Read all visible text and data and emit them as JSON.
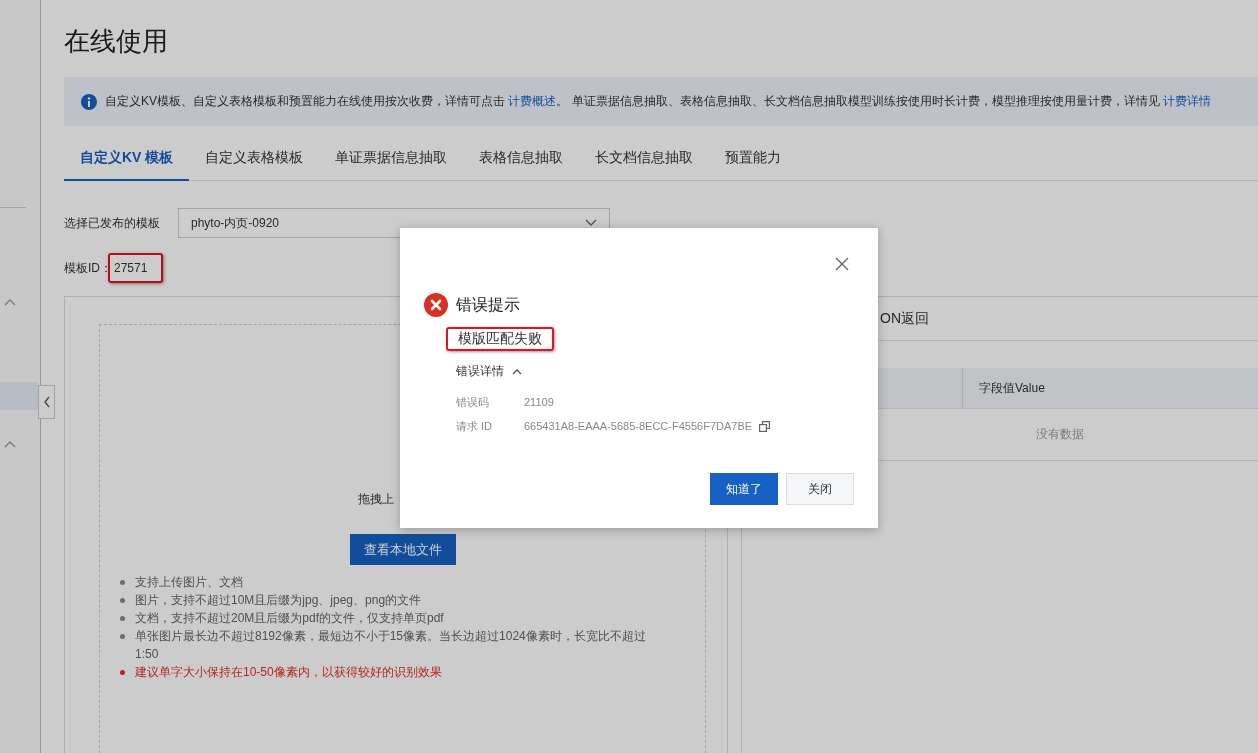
{
  "page_title": "在线使用",
  "notice": {
    "segments": [
      {
        "kind": "text",
        "text": "自定义KV模板、自定义表格模板和预置能力在线使用按次收费，详情可点击 "
      },
      {
        "kind": "link",
        "text": "计费概述"
      },
      {
        "kind": "text",
        "text": "。 单证票据信息抽取、表格信息抽取、长文档信息抽取模型训练按使用时长计费，模型推理按使用量计费，详情见 "
      },
      {
        "kind": "link",
        "text": "计费详情"
      }
    ]
  },
  "tabs": [
    {
      "label": "自定义KV 模板",
      "selected": true
    },
    {
      "label": "自定义表格模板",
      "selected": false
    },
    {
      "label": "单证票据信息抽取",
      "selected": false
    },
    {
      "label": "表格信息抽取",
      "selected": false
    },
    {
      "label": "长文档信息抽取",
      "selected": false
    },
    {
      "label": "预置能力",
      "selected": false
    }
  ],
  "template_select": {
    "label": "选择已发布的模板",
    "value": "phyto-内页-0920"
  },
  "template_id": {
    "label": "模板ID：",
    "value": "27571",
    "highlighted": true
  },
  "upload": {
    "partial_hint": "拖拽上",
    "button": "查看本地文件",
    "rules": [
      {
        "kind": "normal",
        "text": "支持上传图片、文档"
      },
      {
        "kind": "normal",
        "text": "图片，支持不超过10M且后缀为jpg、jpeg、png的文件"
      },
      {
        "kind": "normal",
        "text": "文档，支持不超过20M且后缀为pdf的文件，仅支持单页pdf"
      },
      {
        "kind": "normal",
        "text": "单张图片最长边不超过8192像素，最短边不小于15像素。当长边超过1024像素时，长宽比不超过1:50"
      },
      {
        "kind": "warning",
        "text": "建议单字大小保持在10-50像素内，以获得较好的识别效果"
      }
    ]
  },
  "result": {
    "title_fragment": "ON返回",
    "value_column": "字段值Value",
    "empty_text": "没有数据"
  },
  "dialog": {
    "title": "错误提示",
    "message": "模版匹配失败",
    "message_highlighted": true,
    "details_label": "错误详情",
    "details_expanded": true,
    "details": [
      {
        "label": "错误码",
        "value": "21109",
        "copyable": false
      },
      {
        "label": "请求 ID",
        "value": "665431A8-EAAA-5685-8ECC-F4556F7DA7BE",
        "copyable": true
      }
    ],
    "buttons": [
      {
        "label": "知道了",
        "kind": "primary"
      },
      {
        "label": "关闭",
        "kind": "default"
      }
    ]
  }
}
